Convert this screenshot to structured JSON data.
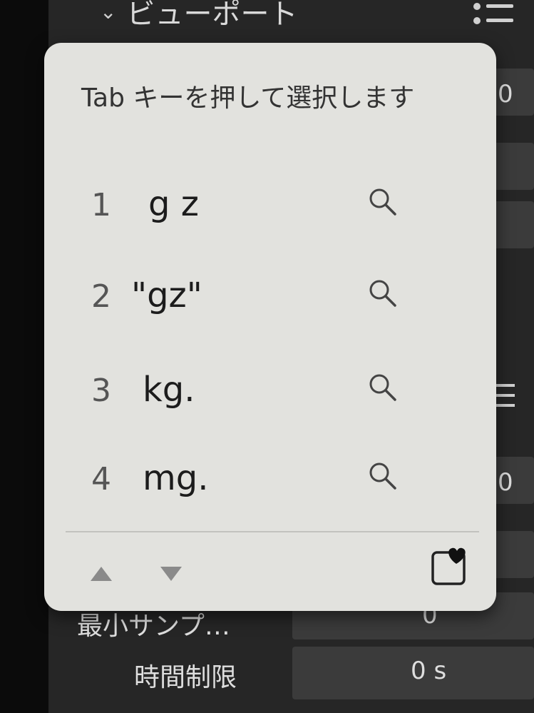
{
  "background_panel": {
    "header_title": "ビューポート",
    "header_chevron_icon": "chevron-down-icon",
    "header_menu_icon": "list-menu-icon",
    "right_field_values": [
      "0",
      "0"
    ],
    "partial_label": "最小サンプ…",
    "min_samples_value": "0",
    "time_limit_label": "時間制限",
    "time_limit_value": "0 s"
  },
  "popup": {
    "title": "Tab キーを押して選択します",
    "candidates": [
      {
        "number": "1",
        "text": "g z",
        "icon": "search-icon"
      },
      {
        "number": "2",
        "text": "\"gz\"",
        "icon": "search-icon"
      },
      {
        "number": "3",
        "text": "kg.",
        "icon": "search-icon"
      },
      {
        "number": "4",
        "text": "mg.",
        "icon": "search-icon"
      }
    ],
    "footer": {
      "prev_icon": "triangle-up-icon",
      "next_icon": "triangle-down-icon",
      "pin_icon": "heart-pin-icon"
    }
  },
  "colors": {
    "popup_background": "#e2e2de",
    "panel_background": "#262626",
    "field_background": "#3b3b3b"
  }
}
